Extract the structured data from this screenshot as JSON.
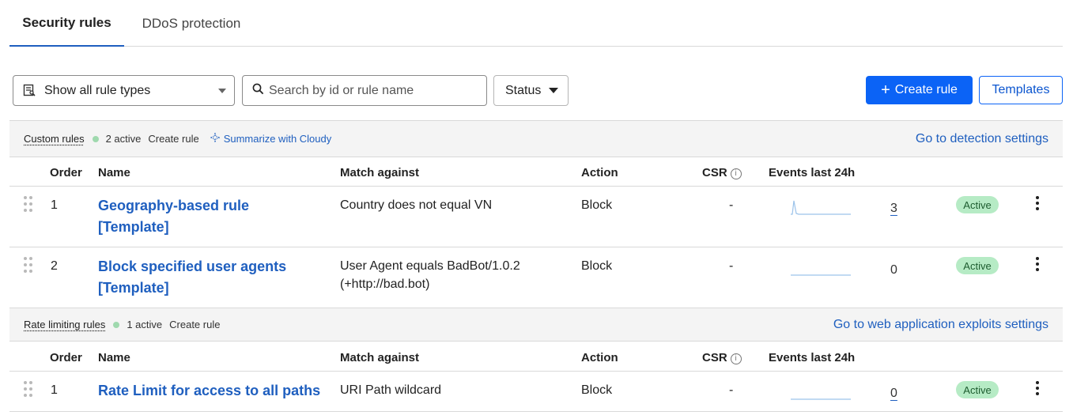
{
  "tabs": [
    {
      "label": "Security rules",
      "active": true
    },
    {
      "label": "DDoS protection",
      "active": false
    }
  ],
  "toolbar": {
    "rule_type_select": "Show all rule types",
    "search_placeholder": "Search by id or rule name",
    "status_label": "Status",
    "create_label": "Create rule",
    "templates_label": "Templates"
  },
  "custom": {
    "title": "Custom rules",
    "active_count": "2 active",
    "create_label": "Create rule",
    "cloudy_label": "Summarize with Cloudy",
    "right_link": "Go to detection settings"
  },
  "rate": {
    "title": "Rate limiting rules",
    "active_count": "1 active",
    "create_label": "Create rule",
    "right_link": "Go to web application exploits settings"
  },
  "columns": {
    "order": "Order",
    "name": "Name",
    "match": "Match against",
    "action": "Action",
    "csr": "CSR",
    "csr_info": "i",
    "events": "Events last 24h"
  },
  "custom_rules": [
    {
      "order": "1",
      "name_line1": "Geography-based rule",
      "name_line2": "[Template]",
      "match_line1": "Country does not equal VN",
      "match_line2": "",
      "action": "Block",
      "csr": "-",
      "events": "3",
      "status": "Active"
    },
    {
      "order": "2",
      "name_line1": "Block specified user agents",
      "name_line2": "[Template]",
      "match_line1": "User Agent equals BadBot/1.0.2",
      "match_line2": "(+http://bad.bot)",
      "action": "Block",
      "csr": "-",
      "events": "0",
      "status": "Active"
    }
  ],
  "rate_rules": [
    {
      "order": "1",
      "name_line1": "Rate Limit for access to all paths",
      "match_line1": "URI Path wildcard",
      "action": "Block",
      "csr": "-",
      "events": "0",
      "status": "Active"
    }
  ],
  "colors": {
    "primary": "#0b63f6",
    "link": "#1f5fbf",
    "badge_bg": "#b6ebc5",
    "active_dot": "#9fd9ae",
    "sparkline": "#9cc3ea"
  }
}
